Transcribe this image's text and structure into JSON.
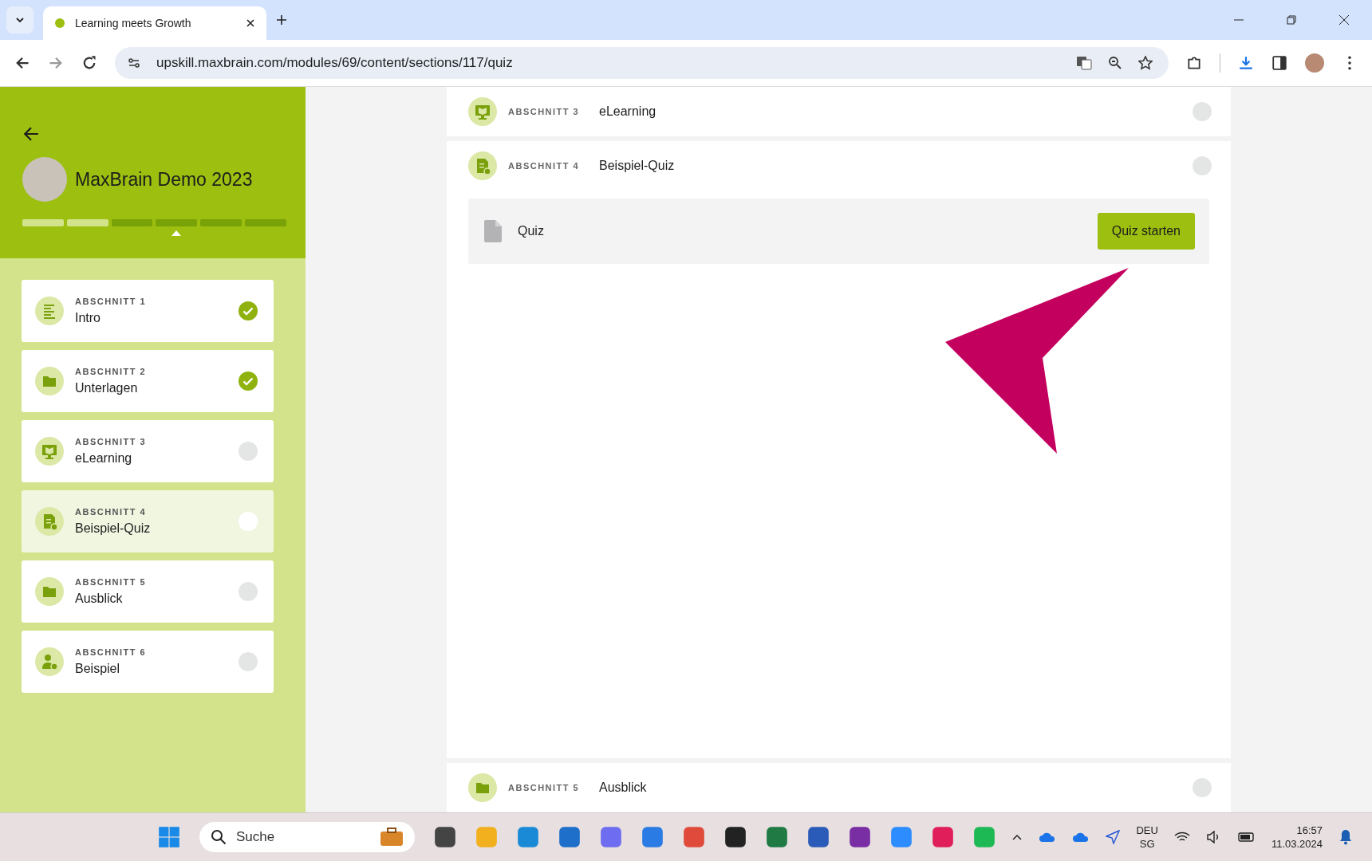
{
  "browser": {
    "tab_title": "Learning meets Growth",
    "url": "upskill.maxbrain.com/modules/69/content/sections/117/quiz"
  },
  "sidebar": {
    "course_title": "MaxBrain Demo 2023",
    "sections": [
      {
        "label": "ABSCHNITT 1",
        "title": "Intro",
        "kind": "lines",
        "completed": true,
        "selected": false
      },
      {
        "label": "ABSCHNITT 2",
        "title": "Unterlagen",
        "kind": "folder",
        "completed": true,
        "selected": false
      },
      {
        "label": "ABSCHNITT 3",
        "title": "eLearning",
        "kind": "monitor",
        "completed": false,
        "selected": false
      },
      {
        "label": "ABSCHNITT 4",
        "title": "Beispiel-Quiz",
        "kind": "quiz",
        "completed": false,
        "selected": true
      },
      {
        "label": "ABSCHNITT 5",
        "title": "Ausblick",
        "kind": "folder",
        "completed": false,
        "selected": false
      },
      {
        "label": "ABSCHNITT 6",
        "title": "Beispiel",
        "kind": "person",
        "completed": false,
        "selected": false
      }
    ]
  },
  "main": {
    "sections": [
      {
        "label": "ABSCHNITT 3",
        "title": "eLearning",
        "kind": "monitor",
        "expanded": false
      },
      {
        "label": "ABSCHNITT 4",
        "title": "Beispiel-Quiz",
        "kind": "quiz",
        "expanded": true,
        "content": {
          "title": "Quiz",
          "button": "Quiz starten"
        }
      }
    ],
    "bottom_section": {
      "label": "ABSCHNITT 5",
      "title": "Ausblick",
      "kind": "folder"
    }
  },
  "taskbar": {
    "search_placeholder": "Suche",
    "language": "DEU",
    "layout": "SG",
    "time": "16:57",
    "date": "11.03.2024"
  }
}
